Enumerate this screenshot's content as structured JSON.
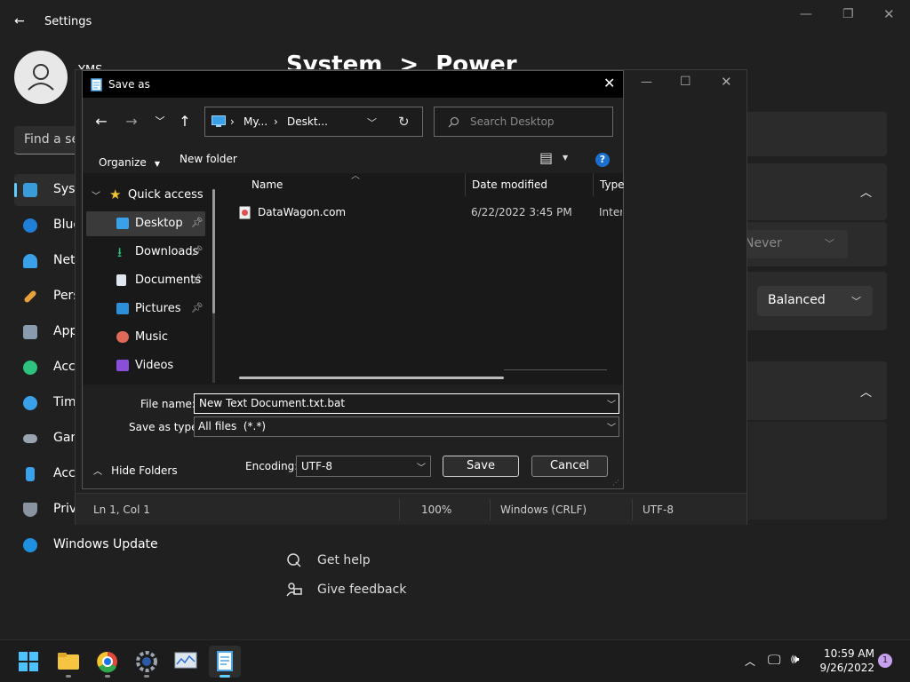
{
  "settings": {
    "title": "Settings",
    "user_initials": "YMS",
    "search_placeholder": "Find a set",
    "breadcrumb": {
      "parent": "System",
      "separator": ">",
      "current": "Power"
    },
    "nav": [
      {
        "label": "Syst",
        "icon": "monitor-icon"
      },
      {
        "label": "Blue",
        "icon": "bluetooth-icon"
      },
      {
        "label": "Netw",
        "icon": "wifi-icon"
      },
      {
        "label": "Pers",
        "icon": "brush-icon"
      },
      {
        "label": "App",
        "icon": "apps-icon"
      },
      {
        "label": "Acco",
        "icon": "person-icon"
      },
      {
        "label": "Time",
        "icon": "clock-icon"
      },
      {
        "label": "Gam",
        "icon": "gamepad-icon"
      },
      {
        "label": "Acce",
        "icon": "accessibility-icon"
      },
      {
        "label": "Priv",
        "icon": "shield-icon"
      },
      {
        "label": "Windows Update",
        "icon": "update-icon"
      }
    ],
    "never_value": "Never",
    "power_mode_value": "Balanced",
    "help_links": [
      {
        "label": "Get help",
        "icon": "help-icon"
      },
      {
        "label": "Give feedback",
        "icon": "feedback-icon"
      }
    ]
  },
  "notepad": {
    "status": {
      "position": "Ln 1, Col 1",
      "zoom": "100%",
      "line_ending": "Windows (CRLF)",
      "encoding": "UTF-8"
    }
  },
  "dialog": {
    "title": "Save as",
    "path": [
      "My...",
      "Deskt..."
    ],
    "search_placeholder": "Search Desktop",
    "organize_label": "Organize",
    "new_folder_label": "New folder",
    "help_glyph": "?",
    "tree": [
      {
        "label": "Quick access",
        "icon": "star-icon",
        "pinned": false
      },
      {
        "label": "Desktop",
        "icon": "desktop-icon",
        "pinned": true
      },
      {
        "label": "Downloads",
        "icon": "download-icon",
        "pinned": true
      },
      {
        "label": "Documents",
        "icon": "documents-icon",
        "pinned": true
      },
      {
        "label": "Pictures",
        "icon": "pictures-icon",
        "pinned": true
      },
      {
        "label": "Music",
        "icon": "music-icon",
        "pinned": false
      },
      {
        "label": "Videos",
        "icon": "videos-icon",
        "pinned": false
      }
    ],
    "columns": [
      "Name",
      "Date modified",
      "Type"
    ],
    "files": [
      {
        "name": "DataWagon.com",
        "date": "6/22/2022 3:45 PM",
        "type": "Intern"
      }
    ],
    "file_name_label": "File name:",
    "file_name_value": "New Text Document.txt.bat",
    "save_type_label": "Save as type:",
    "save_type_value": "All files  (*.*)",
    "hide_folders_label": "Hide Folders",
    "encoding_label": "Encoding:",
    "encoding_value": "UTF-8",
    "save_label": "Save",
    "cancel_label": "Cancel"
  },
  "taskbar": {
    "apps": [
      "start-icon",
      "file-explorer-icon",
      "chrome-icon",
      "settings-icon",
      "monitor-app-icon",
      "notepad-icon"
    ],
    "time": "10:59 AM",
    "date": "9/26/2022",
    "notification_count": "1"
  },
  "colors": {
    "accent": "#60cdff",
    "background": "#202020",
    "dialog": "#191919"
  }
}
